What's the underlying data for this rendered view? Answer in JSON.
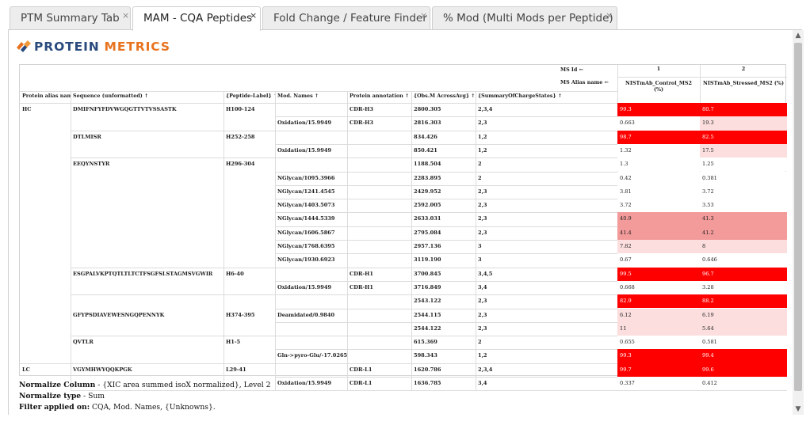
{
  "tabs": [
    {
      "label": "PTM Summary Tab",
      "active": false
    },
    {
      "label": "MAM - CQA Peptides",
      "active": true
    },
    {
      "label": "Fold Change / Feature Finder",
      "active": false
    },
    {
      "label": "% Mod (Multi Mods per Peptide)",
      "active": false
    }
  ],
  "tab_close_glyph": "×",
  "logo": {
    "word1": "PROTEIN",
    "word2": "METRICS",
    "icon": "protein-metrics-logo-icon"
  },
  "grid": {
    "ms_id_label": "MS Id ←",
    "ms_alias_label": "MS Alias name ←",
    "ms_ids": [
      "1",
      "2"
    ],
    "ms_aliases": [
      "NISTmAb_Control_MS2 (%)",
      "NISTmAb_Stressed_MS2 (%)"
    ],
    "columns": [
      "Protein alias name",
      "Sequence (unformatted) ↑",
      "{Peptide-Label} ↑",
      "Mod. Names ↑",
      "Protein annotation ↑",
      "{Obs.M AcrossAvg} ↑",
      "{SummaryOfChargeStates} ↑"
    ],
    "heat_colors": {
      "high": "#ff0000",
      "mid": "#f39a9a",
      "low": "#fcdede",
      "none": "#ffffff"
    },
    "rows": [
      {
        "protein": "HC",
        "sequence": "DMIFNFYFDVWGQGTTVTVSSASTK",
        "label": "H100-124",
        "mod": "",
        "annot": "CDR-H3",
        "mass": "2800.305",
        "charges": "2,3,4",
        "v1": "99.3",
        "v2": "80.7"
      },
      {
        "protein": "",
        "sequence": "",
        "label": "",
        "mod": "Oxidation/15.9949",
        "annot": "CDR-H3",
        "mass": "2816.303",
        "charges": "2,3",
        "v1": "0.663",
        "v2": "19.3"
      },
      {
        "protein": "",
        "sequence": "DTLMISR",
        "label": "H252-258",
        "mod": "",
        "annot": "",
        "mass": "834.426",
        "charges": "1,2",
        "v1": "98.7",
        "v2": "82.5"
      },
      {
        "protein": "",
        "sequence": "",
        "label": "",
        "mod": "Oxidation/15.9949",
        "annot": "",
        "mass": "850.421",
        "charges": "1,2",
        "v1": "1.32",
        "v2": "17.5"
      },
      {
        "protein": "",
        "sequence": "EEQYNSTYR",
        "label": "H296-304",
        "mod": "",
        "annot": "",
        "mass": "1188.504",
        "charges": "2",
        "v1": "1.3",
        "v2": "1.25"
      },
      {
        "protein": "",
        "sequence": "",
        "label": "",
        "mod": "NGlycan/1095.3966",
        "annot": "",
        "mass": "2283.895",
        "charges": "2",
        "v1": "0.42",
        "v2": "0.381"
      },
      {
        "protein": "",
        "sequence": "",
        "label": "",
        "mod": "NGlycan/1241.4545",
        "annot": "",
        "mass": "2429.952",
        "charges": "2,3",
        "v1": "3.81",
        "v2": "3.72"
      },
      {
        "protein": "",
        "sequence": "",
        "label": "",
        "mod": "NGlycan/1403.5073",
        "annot": "",
        "mass": "2592.005",
        "charges": "2,3",
        "v1": "3.72",
        "v2": "3.53"
      },
      {
        "protein": "",
        "sequence": "",
        "label": "",
        "mod": "NGlycan/1444.5339",
        "annot": "",
        "mass": "2633.031",
        "charges": "2,3",
        "v1": "40.9",
        "v2": "41.3"
      },
      {
        "protein": "",
        "sequence": "",
        "label": "",
        "mod": "NGlycan/1606.5867",
        "annot": "",
        "mass": "2795.084",
        "charges": "2,3",
        "v1": "41.4",
        "v2": "41.2"
      },
      {
        "protein": "",
        "sequence": "",
        "label": "",
        "mod": "NGlycan/1768.6395",
        "annot": "",
        "mass": "2957.136",
        "charges": "3",
        "v1": "7.82",
        "v2": "8"
      },
      {
        "protein": "",
        "sequence": "",
        "label": "",
        "mod": "NGlycan/1930.6923",
        "annot": "",
        "mass": "3119.190",
        "charges": "3",
        "v1": "0.67",
        "v2": "0.646"
      },
      {
        "protein": "",
        "sequence": "ESGPALVKPTQTLTLTCTFSGFSLSTAGMSVGWIR",
        "label": "H6-40",
        "mod": "",
        "annot": "CDR-H1",
        "mass": "3700.845",
        "charges": "3,4,5",
        "v1": "99.5",
        "v2": "96.7"
      },
      {
        "protein": "",
        "sequence": "",
        "label": "",
        "mod": "Oxidation/15.9949",
        "annot": "CDR-H1",
        "mass": "3716.849",
        "charges": "3,4",
        "v1": "0.668",
        "v2": "3.28"
      },
      {
        "protein": "",
        "sequence": "",
        "label": "",
        "mod": "",
        "annot": "",
        "mass": "2543.122",
        "charges": "2,3",
        "v1": "82.9",
        "v2": "88.2"
      },
      {
        "protein": "",
        "sequence": "GFYPSDIAVEWESNGQPENNYK",
        "label": "H374-395",
        "mod": "Deamidated/0.9840",
        "annot": "",
        "mass": "2544.115",
        "charges": "2,3",
        "v1": "6.12",
        "v2": "6.19"
      },
      {
        "protein": "",
        "sequence": "",
        "label": "",
        "mod": "",
        "annot": "",
        "mass": "2544.122",
        "charges": "2,3",
        "v1": "11",
        "v2": "5.64"
      },
      {
        "protein": "",
        "sequence": "QVTLR",
        "label": "H1-5",
        "mod": "",
        "annot": "",
        "mass": "615.369",
        "charges": "2",
        "v1": "0.655",
        "v2": "0.581"
      },
      {
        "protein": "",
        "sequence": "",
        "label": "",
        "mod": "Gln->pyro-Glu/-17.0265",
        "annot": "",
        "mass": "598.343",
        "charges": "1,2",
        "v1": "99.3",
        "v2": "99.4"
      },
      {
        "protein": "LC",
        "sequence": "VGYMHWYQQKPGK",
        "label": "L29-41",
        "mod": "",
        "annot": "CDR-L1",
        "mass": "1620.786",
        "charges": "2,3,4",
        "v1": "99.7",
        "v2": "99.6"
      },
      {
        "protein": "",
        "sequence": "",
        "label": "",
        "mod": "Oxidation/15.9949",
        "annot": "CDR-L1",
        "mass": "1636.785",
        "charges": "3,4",
        "v1": "0.337",
        "v2": "0.412"
      }
    ]
  },
  "footer": {
    "normalize_column_label": "Normalize Column",
    "normalize_column_value": " - {XIC area summed isoX normalized}, Level 2",
    "normalize_type_label": "Normalize type",
    "normalize_type_value": " - Sum",
    "filter_label": "Filter applied on:",
    "filter_value": " CQA, Mod. Names, {Unknowns}."
  }
}
